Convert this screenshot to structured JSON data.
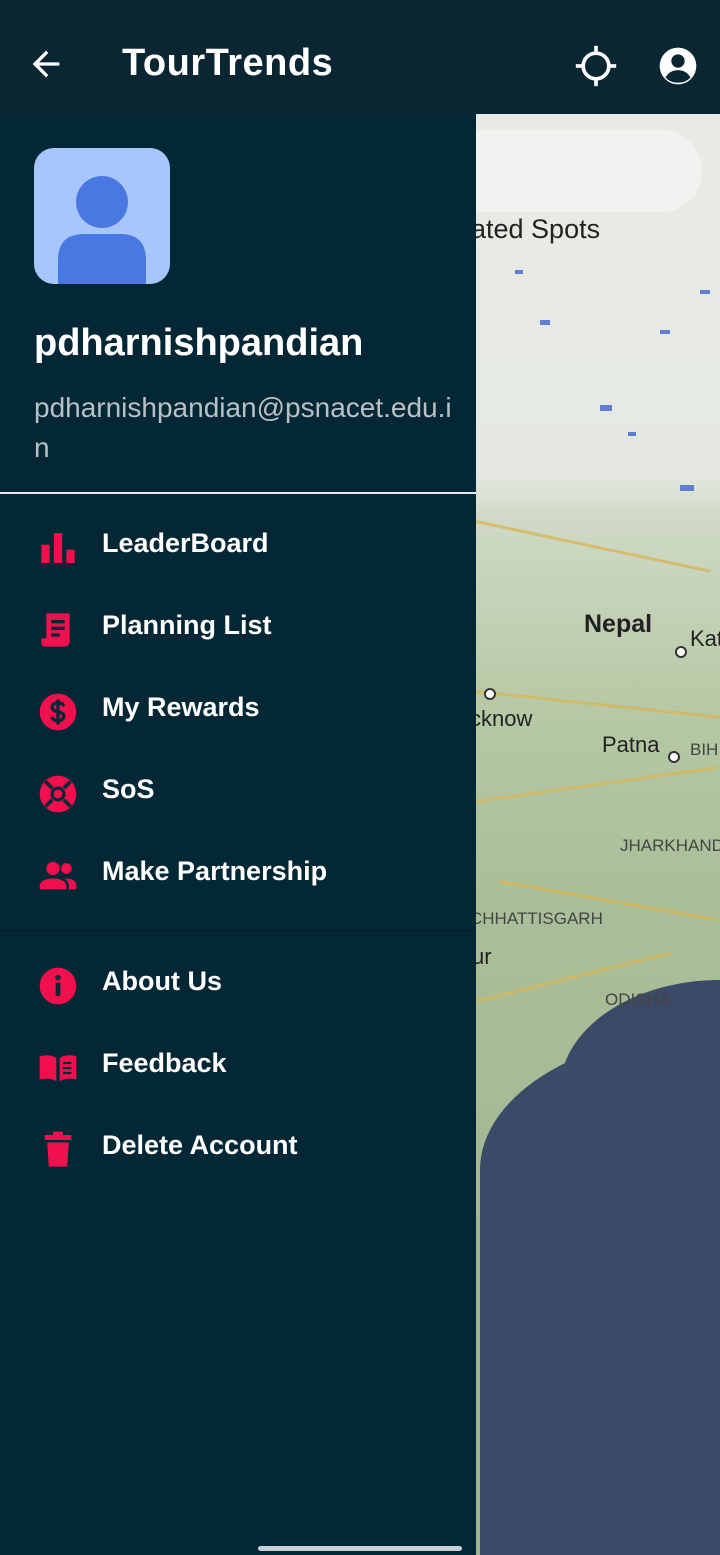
{
  "app": {
    "title": "TourTrends"
  },
  "appbar": {
    "back_icon": "arrow-left-icon",
    "location_icon": "gps-crosshair-icon",
    "account_icon": "account-circle-icon"
  },
  "profile": {
    "username": "pdharnishpandian",
    "email": "pdharnishpandian@psnacet.edu.in"
  },
  "menu_primary": [
    {
      "label": "LeaderBoard",
      "icon": "bar-chart-icon"
    },
    {
      "label": "Planning List",
      "icon": "list-receipt-icon"
    },
    {
      "label": "My Rewards",
      "icon": "dollar-coin-icon"
    },
    {
      "label": "SoS",
      "icon": "lifebuoy-icon"
    },
    {
      "label": "Make Partnership",
      "icon": "people-icon"
    }
  ],
  "menu_secondary": [
    {
      "label": "About Us",
      "icon": "info-icon"
    },
    {
      "label": "Feedback",
      "icon": "open-book-icon"
    },
    {
      "label": "Delete Account",
      "icon": "trash-icon"
    }
  ],
  "map": {
    "top_rated_label": "rated Spots",
    "places": {
      "nepal": "Nepal",
      "kathmandu": "Kat",
      "lucknow": "cknow",
      "patna": "Patna",
      "bihar": "BIH",
      "jharkhand": "JHARKHAND",
      "chhattisgarh": "CHHATTISGARH",
      "nagpur": "ur",
      "odisha": "ODISHA"
    }
  },
  "colors": {
    "accent": "#f0104d",
    "drawer_bg": "#032735",
    "appbar_bg": "#0a2633",
    "avatar_bg": "#a7c6fb",
    "avatar_fg": "#4a78e3"
  }
}
